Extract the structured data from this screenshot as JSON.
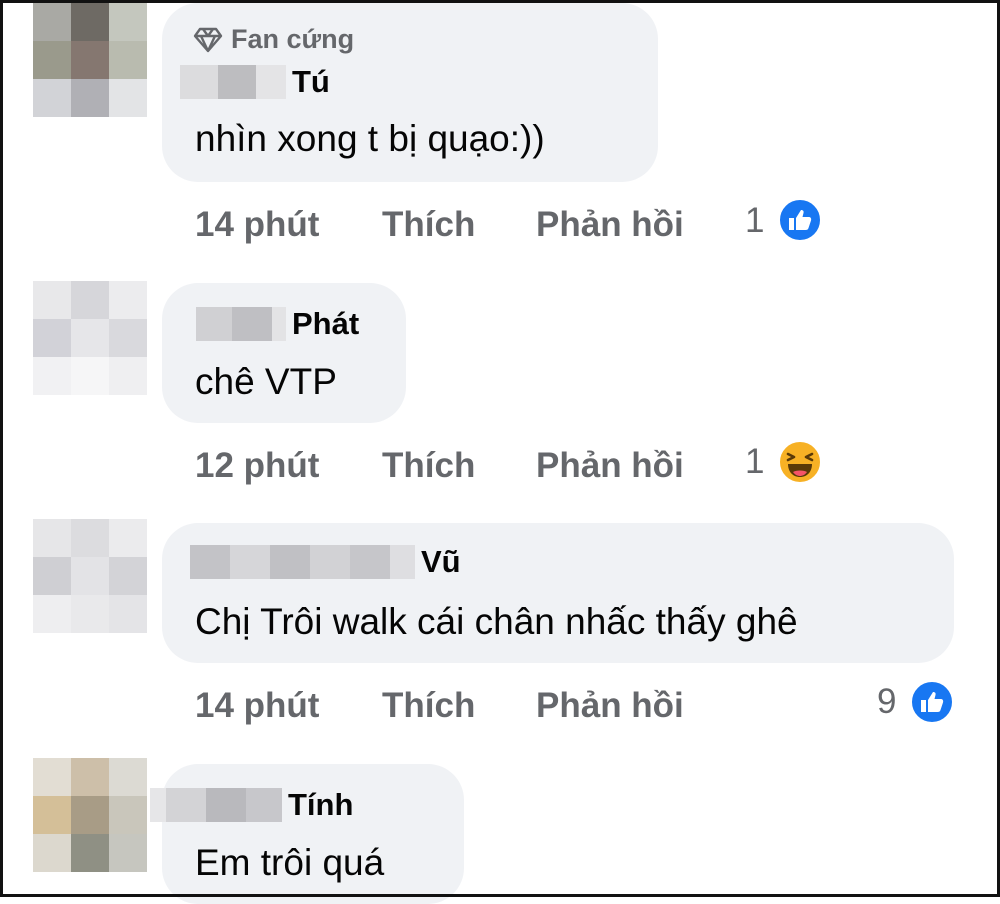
{
  "colors": {
    "bubble_bg": "#f0f2f5",
    "meta_text": "#65676b",
    "main_text": "#050505",
    "like_blue": "#1877f2",
    "haha_yellow": "#f7b125"
  },
  "comments": [
    {
      "badge_icon": "diamond-icon",
      "badge": "Fan cứng",
      "author": "Tú",
      "text": "nhìn xong t bị quạo:))",
      "time": "14 phút",
      "like_label": "Thích",
      "reply_label": "Phản hồi",
      "reaction_count": "1",
      "reaction_icon": "like-icon"
    },
    {
      "author": "Phát",
      "text": "chê VTP",
      "time": "12 phút",
      "like_label": "Thích",
      "reply_label": "Phản hồi",
      "reaction_count": "1",
      "reaction_icon": "haha-icon"
    },
    {
      "author": "Vũ",
      "text": "Chị Trôi walk cái chân nhấc thấy ghê",
      "time": "14 phút",
      "like_label": "Thích",
      "reply_label": "Phản hồi",
      "reaction_count": "9",
      "reaction_icon": "like-icon"
    },
    {
      "author": "Tính",
      "text": "Em trôi quá"
    }
  ]
}
